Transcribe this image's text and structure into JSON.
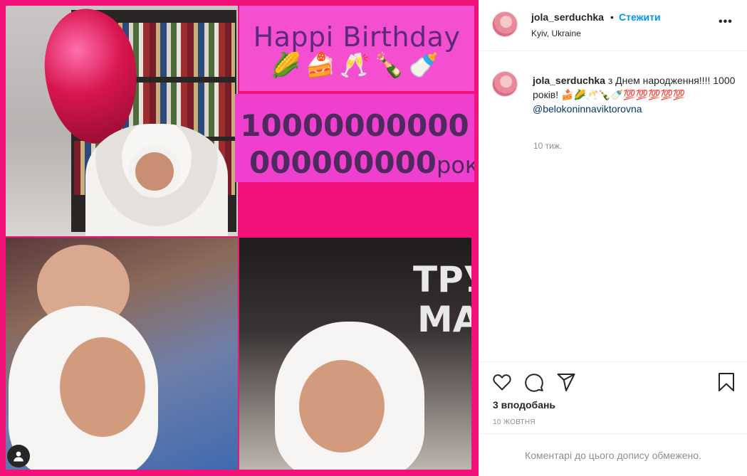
{
  "post_image": {
    "headline": "Happi Birthday",
    "emojis": "🌽🍰🥂🍾🍼",
    "big_number_line1": "10000000000",
    "big_number_line2": "000000000",
    "big_number_suffix": "років!!",
    "sign_line1": "ТРУ",
    "sign_line2": "МА",
    "background_color": "#f2127a"
  },
  "header": {
    "username": "jola_serduchka",
    "dot": "•",
    "follow_label": "Стежити",
    "location": "Kyiv, Ukraine",
    "more_label": "•••"
  },
  "caption": {
    "username": "jola_serduchka",
    "text": " з Днем народження!!!! 1000 років! 🍰🌽🥂🍾🍼💯💯💯💯💯",
    "mention": "@belokoninnaviktorovna",
    "time": "10 тиж."
  },
  "actions": {
    "like_icon": "heart-icon",
    "comment_icon": "comment-icon",
    "share_icon": "share-icon",
    "save_icon": "bookmark-icon"
  },
  "likes": "3 вподобань",
  "date": "10 ЖОВТНЯ",
  "comments_disabled": "Коментарі до цього допису обмежено.",
  "colors": {
    "link_blue": "#0095f6",
    "mention_blue": "#00376b",
    "muted_gray": "#8e8e8e"
  }
}
